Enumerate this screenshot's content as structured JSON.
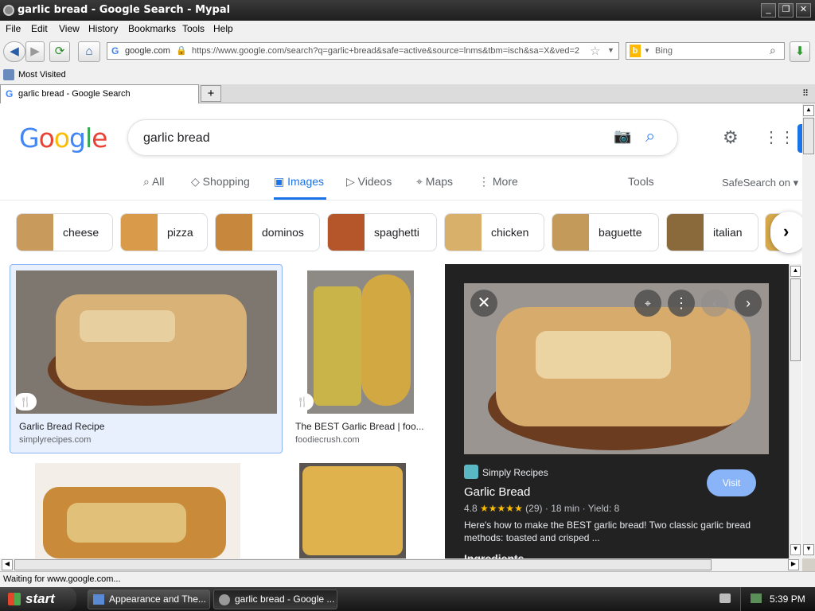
{
  "window": {
    "title": "garlic bread - Google Search - Mypal"
  },
  "menu": [
    "File",
    "Edit",
    "View",
    "History",
    "Bookmarks",
    "Tools",
    "Help"
  ],
  "nav": {
    "site_badge": "google.com",
    "url": "https://www.google.com/search?q=garlic+bread&safe=active&source=lnms&tbm=isch&sa=X&ved=2",
    "search_engine": "Bing"
  },
  "bookmarks": {
    "most_visited": "Most Visited"
  },
  "tab": {
    "label": "garlic bread - Google Search"
  },
  "google": {
    "logo": "Google",
    "query": "garlic bread",
    "tabs": [
      "All",
      "Shopping",
      "Images",
      "Videos",
      "Maps",
      "More"
    ],
    "tools": "Tools",
    "safesearch": "SafeSearch on",
    "chips": [
      "cheese",
      "pizza",
      "dominos",
      "spaghetti",
      "chicken",
      "baguette",
      "italian"
    ]
  },
  "results": [
    {
      "title": "Garlic Bread Recipe",
      "source": "simplyrecipes.com"
    },
    {
      "title": "The BEST Garlic Bread | foo...",
      "source": "foodiecrush.com"
    }
  ],
  "panel": {
    "source": "Simply Recipes",
    "title": "Garlic Bread",
    "rating": "4.8",
    "reviews": "(29)",
    "time": "18 min",
    "yield": "Yield: 8",
    "desc": "Here's how to make the BEST garlic bread! Two classic garlic bread methods: toasted and crisped ...",
    "visit": "Visit",
    "more": "Ingredients"
  },
  "status": {
    "text": "Waiting for www.google.com..."
  },
  "taskbar": {
    "start": "start",
    "items": [
      "Appearance and The...",
      "garlic bread - Google ..."
    ],
    "clock": "5:39 PM"
  },
  "colors": {
    "google_blue": "#1a73e8",
    "visit_button": "#8ab4f8",
    "star": "#fbbc04",
    "panel_bg": "#222222"
  }
}
